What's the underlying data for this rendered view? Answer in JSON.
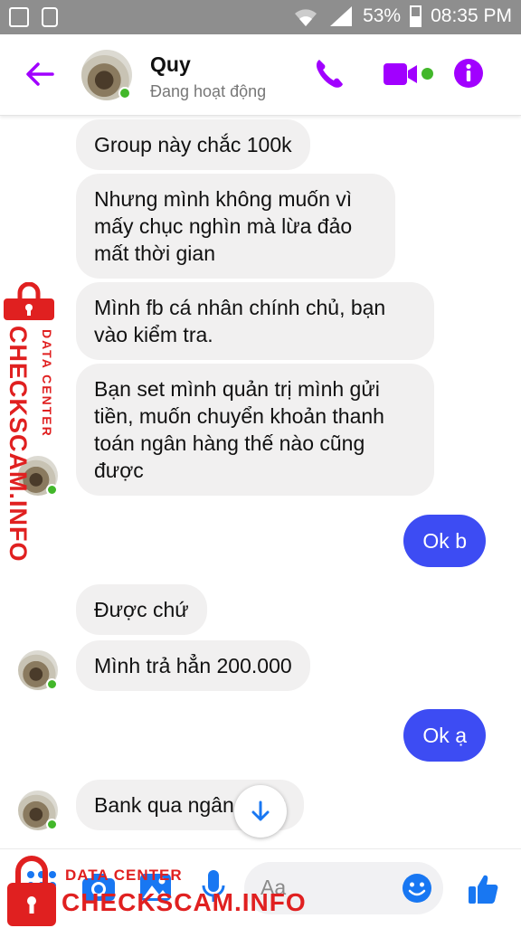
{
  "status_bar": {
    "battery": "53%",
    "time": "08:35 PM",
    "left_icons": [
      "image-icon",
      "recycle-icon"
    ],
    "right_icons": [
      "wifi-icon",
      "signal-icon",
      "battery-icon"
    ]
  },
  "header": {
    "contact_name": "Quy",
    "contact_status": "Đang hoạt động",
    "icons": [
      "back-arrow-icon",
      "phone-icon",
      "video-camera-icon",
      "info-icon"
    ]
  },
  "messages": [
    {
      "sender": "them",
      "text": "Group này chắc 100k"
    },
    {
      "sender": "them",
      "text": "Nhưng mình không muốn vì mấy chục nghìn mà lừa đảo mất thời gian"
    },
    {
      "sender": "them",
      "text": "Mình fb cá nhân chính chủ, bạn vào kiểm tra."
    },
    {
      "sender": "them",
      "text": "Bạn set mình quản trị mình gửi tiền, muốn chuyển khoản thanh toán ngân hàng thế nào cũng được"
    },
    {
      "sender": "me",
      "text": "Ok b"
    },
    {
      "sender": "them",
      "text": "Được chứ"
    },
    {
      "sender": "them",
      "text": "Mình trả hẳn 200.000"
    },
    {
      "sender": "me",
      "text": "Ok ạ"
    },
    {
      "sender": "them",
      "text": "Bank qua ngân hàng"
    }
  ],
  "composer": {
    "placeholder": "Aa",
    "icons": [
      "menu-icon",
      "camera-icon",
      "image-icon",
      "microphone-icon",
      "emoji-icon",
      "thumbs-up-icon"
    ]
  },
  "watermark": {
    "side_big": "CHECKSCAM.INFO",
    "side_small": "DATA CENTER",
    "bottom_small": "DATA CENTER",
    "bottom_big": "CHECKSCAM.INFO"
  },
  "colors": {
    "accent": "#a100ff",
    "my_bubble": "#3d4cf3",
    "their_bubble": "#f1f0f0",
    "online": "#42b72a",
    "watermark": "#e02020",
    "messenger_blue": "#1877f2"
  }
}
